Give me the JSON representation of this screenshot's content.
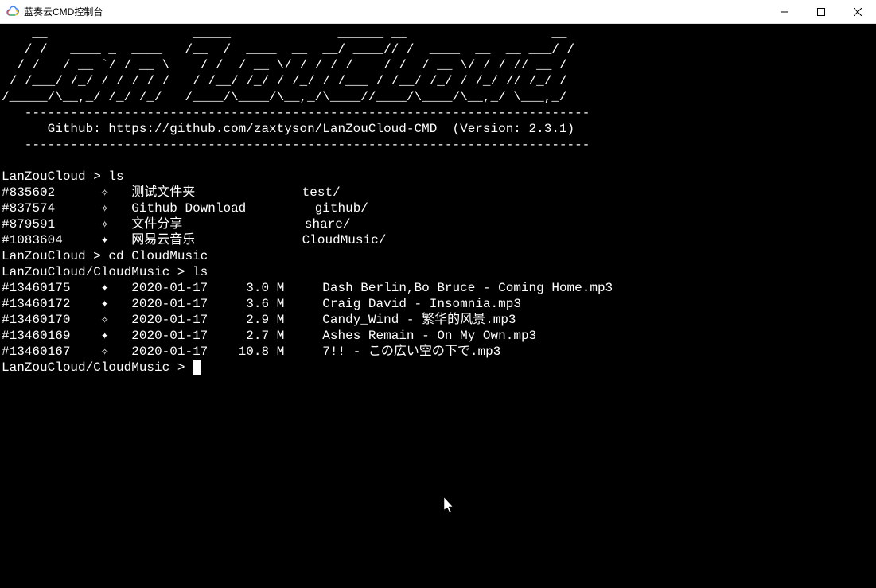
{
  "window": {
    "title": "蓝奏云CMD控制台"
  },
  "banner": {
    "ascii": "    __                   _____              ______ __                   __\n   / /   ____ _  ____   /__  /  ____  __  __/ ____// /  ____  __  __ ___/ /\n  / /   / __ `/ / __ \\    / /  / __ \\/ / / / /    / /  / __ \\/ / / // __ / \n / /___/ /_/ / / / / /   / /__/ /_/ / /_/ / /___ / /__/ /_/ / /_/ // /_/ /  \n/_____/\\__,_/ /_/ /_/   /____/\\____/\\__,_/\\____//____/\\____/\\__,_/ \\___,_/   ",
    "separator": "   --------------------------------------------------------------------------",
    "info": "      Github: https://github.com/zaxtyson/LanZouCloud-CMD  (Version: 2.3.1)"
  },
  "session": {
    "prompt1": "LanZouCloud > ",
    "cmd1": "ls",
    "folders": [
      {
        "id": "#835602",
        "marker": "✧",
        "name": "测试文件夹",
        "alias": "test/"
      },
      {
        "id": "#837574",
        "marker": "✧",
        "name": "Github Download",
        "alias": "github/"
      },
      {
        "id": "#879591",
        "marker": "✧",
        "name": "文件分享",
        "alias": "share/"
      },
      {
        "id": "#1083604",
        "marker": "✦",
        "name": "网易云音乐",
        "alias": "CloudMusic/"
      }
    ],
    "prompt2": "LanZouCloud > ",
    "cmd2": "cd CloudMusic",
    "prompt3": "LanZouCloud/CloudMusic > ",
    "cmd3": "ls",
    "files": [
      {
        "id": "#13460175",
        "marker": "✦",
        "date": "2020-01-17",
        "size": "3.0 M",
        "name": "Dash Berlin,Bo Bruce - Coming Home.mp3"
      },
      {
        "id": "#13460172",
        "marker": "✦",
        "date": "2020-01-17",
        "size": "3.6 M",
        "name": "Craig David - Insomnia.mp3"
      },
      {
        "id": "#13460170",
        "marker": "✧",
        "date": "2020-01-17",
        "size": "2.9 M",
        "name": "Candy_Wind - 繁华的风景.mp3"
      },
      {
        "id": "#13460169",
        "marker": "✦",
        "date": "2020-01-17",
        "size": "2.7 M",
        "name": "Ashes Remain - On My Own.mp3"
      },
      {
        "id": "#13460167",
        "marker": "✧",
        "date": "2020-01-17",
        "size": "10.8 M",
        "name": "7!! - この広い空の下で.mp3"
      }
    ],
    "prompt4": "LanZouCloud/CloudMusic > "
  }
}
